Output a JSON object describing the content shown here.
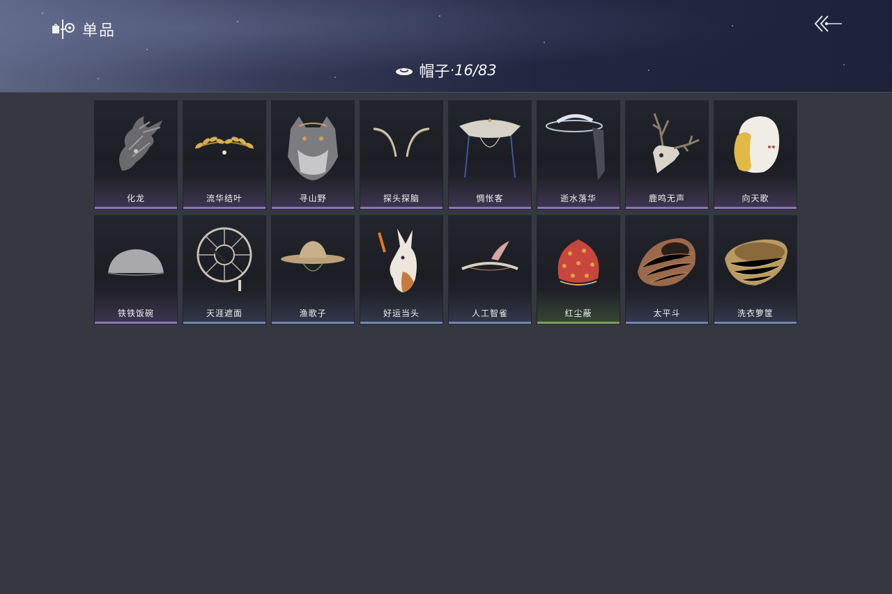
{
  "header": {
    "title": "单品",
    "brand_icon": "wardrobe-icon",
    "back_icon": "back-arrow-icon"
  },
  "category": {
    "icon": "hat-icon",
    "name": "帽子",
    "count": "·16/83"
  },
  "items": [
    {
      "name": "化龙",
      "rarity": "purple",
      "icon": "dragon-head-icon"
    },
    {
      "name": "流华结叶",
      "rarity": "purple",
      "icon": "golden-laurel-icon"
    },
    {
      "name": "寻山野",
      "rarity": "purple",
      "icon": "wolf-head-icon"
    },
    {
      "name": "探头探脑",
      "rarity": "purple",
      "icon": "antenna-feathers-icon"
    },
    {
      "name": "惆怅客",
      "rarity": "purple",
      "icon": "veiled-bamboo-hat-icon"
    },
    {
      "name": "逝水落华",
      "rarity": "purple",
      "icon": "floral-veil-hat-icon"
    },
    {
      "name": "鹿鸣无声",
      "rarity": "purple",
      "icon": "deer-skull-icon"
    },
    {
      "name": "向天歌",
      "rarity": "purple",
      "icon": "duck-hood-icon"
    },
    {
      "name": "铁铁饭碗",
      "rarity": "purple",
      "icon": "iron-bowl-icon"
    },
    {
      "name": "天涯遮面",
      "rarity": "blue",
      "icon": "woven-frame-hat-icon"
    },
    {
      "name": "渔歌子",
      "rarity": "blue",
      "icon": "straw-hat-icon"
    },
    {
      "name": "好运当头",
      "rarity": "blue",
      "icon": "donkey-head-icon"
    },
    {
      "name": "人工智雀",
      "rarity": "blue",
      "icon": "bird-headband-icon"
    },
    {
      "name": "红尘蔽",
      "rarity": "green",
      "icon": "red-cloth-hood-icon"
    },
    {
      "name": "太平斗",
      "rarity": "blue",
      "icon": "woven-basket-hat-icon"
    },
    {
      "name": "洗衣箩筐",
      "rarity": "blue",
      "icon": "laundry-basket-icon"
    }
  ]
}
